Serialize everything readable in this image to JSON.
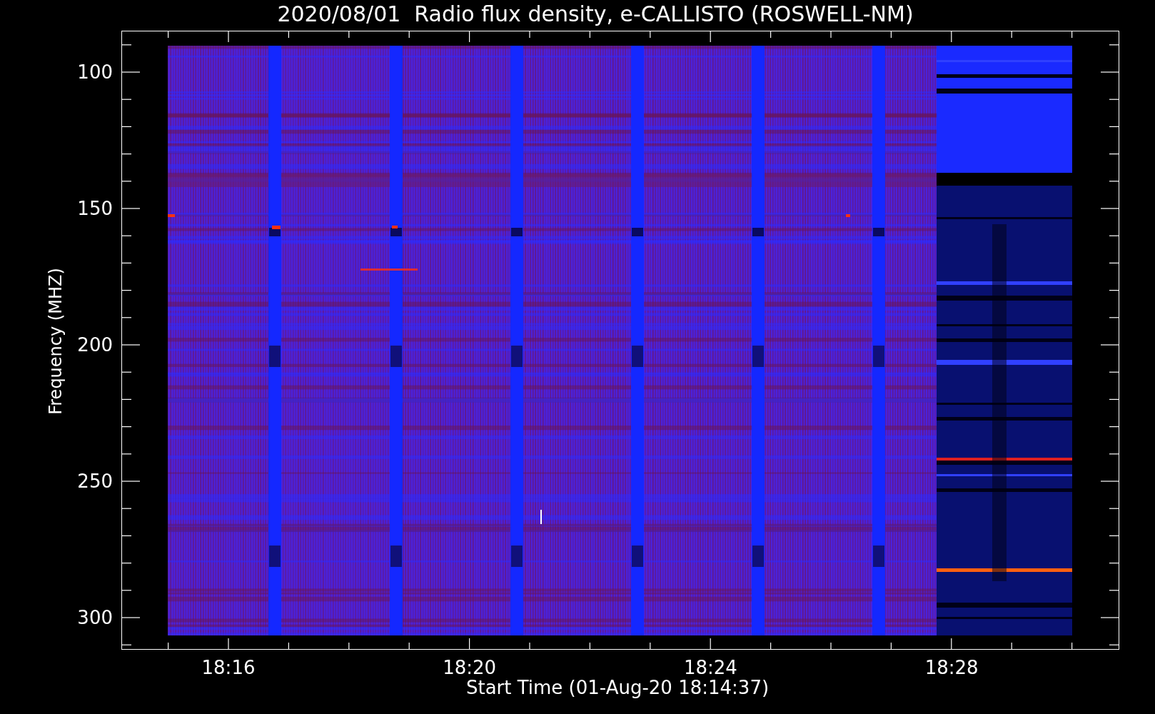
{
  "title": "2020/08/01  Radio flux density, e-CALLISTO (ROSWELL-NM)",
  "y_axis": {
    "label": "Frequency (MHZ)",
    "ticks": [
      "100",
      "150",
      "200",
      "250",
      "300"
    ]
  },
  "x_axis": {
    "label": "Start Time (01-Aug-20 18:14:37)",
    "ticks": [
      "18:16",
      "18:20",
      "18:24",
      "18:28"
    ]
  }
}
